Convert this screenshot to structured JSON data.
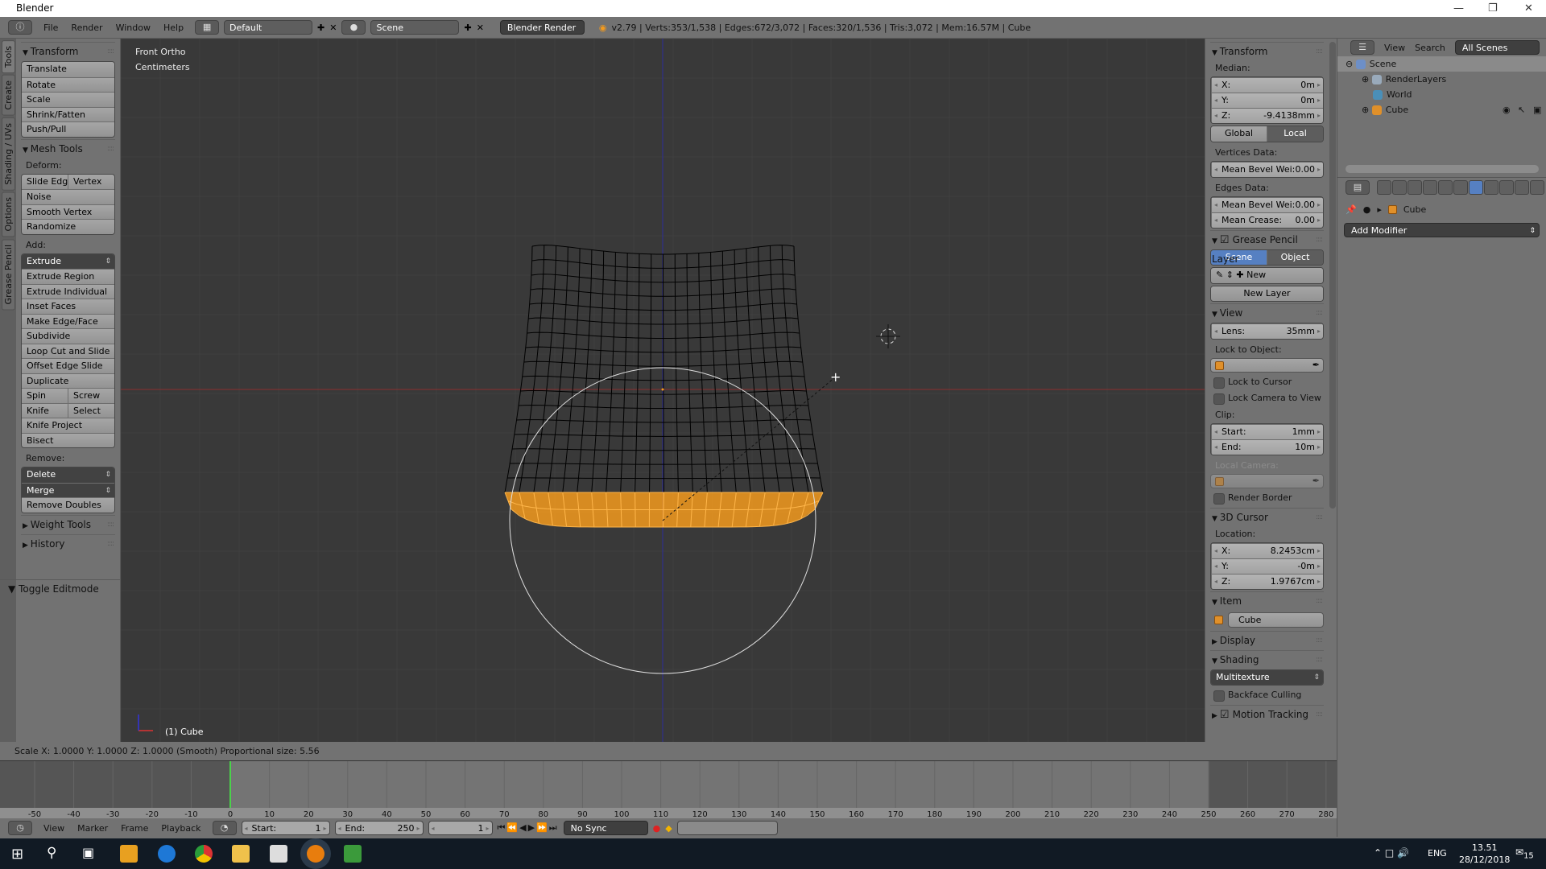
{
  "title_bar": {
    "title": "Blender"
  },
  "header": {
    "menus": [
      "File",
      "Render",
      "Window",
      "Help"
    ],
    "layout": "Default",
    "scene": "Scene",
    "engine": "Blender Render",
    "stats": "v2.79 | Verts:353/1,538 | Edges:672/3,072 | Faces:320/1,536 | Tris:3,072 | Mem:16.57M | Cube"
  },
  "tool_tabs": [
    "Tools",
    "Create",
    "Shading / UVs",
    "Options",
    "Grease Pencil"
  ],
  "tool_shelf": {
    "rows": [
      {
        "t": "h",
        "label": "Transform",
        "open": true
      },
      {
        "t": "g",
        "rows": [
          [
            "Translate"
          ],
          [
            "Rotate"
          ],
          [
            "Scale"
          ],
          [
            "Shrink/Fatten"
          ],
          [
            "Push/Pull"
          ]
        ]
      },
      {
        "t": "h",
        "label": "Mesh Tools",
        "open": true
      },
      {
        "t": "l",
        "label": "Deform:"
      },
      {
        "t": "g",
        "rows": [
          [
            "Slide Edg",
            "Vertex"
          ],
          [
            "Noise"
          ],
          [
            "Smooth Vertex"
          ],
          [
            "Randomize"
          ]
        ]
      },
      {
        "t": "l",
        "label": "Add:"
      },
      {
        "t": "g",
        "dd": [
          0
        ],
        "rows": [
          [
            "Extrude"
          ],
          [
            "Extrude Region"
          ],
          [
            "Extrude Individual"
          ],
          [
            "Inset Faces"
          ],
          [
            "Make Edge/Face"
          ],
          [
            "Subdivide"
          ],
          [
            "Loop Cut and Slide"
          ],
          [
            "Offset Edge Slide"
          ],
          [
            "Duplicate"
          ],
          [
            "Spin",
            "Screw"
          ],
          [
            "Knife",
            "Select"
          ],
          [
            "Knife Project"
          ],
          [
            "Bisect"
          ]
        ]
      },
      {
        "t": "l",
        "label": "Remove:"
      },
      {
        "t": "g",
        "dd": [
          0,
          1
        ],
        "rows": [
          [
            "Delete"
          ],
          [
            "Merge"
          ],
          [
            "Remove Doubles"
          ]
        ]
      },
      {
        "t": "h",
        "label": "Weight Tools",
        "open": false
      },
      {
        "t": "h",
        "label": "History",
        "open": false
      }
    ]
  },
  "toggle_editmode": "Toggle Editmode",
  "viewport": {
    "view_name": "Front Ortho",
    "units": "Centimeters",
    "object_label": "(1) Cube",
    "colors": {
      "background": "#393939",
      "wire": "#000000",
      "selected": "#f39a1d",
      "x_axis": "#8a3030",
      "z_axis": "#30308a"
    }
  },
  "n_panel": {
    "rows": [
      {
        "t": "h",
        "label": "Transform",
        "open": true
      },
      {
        "t": "l",
        "label": "Median:"
      },
      {
        "t": "n",
        "rows": [
          [
            "X:",
            "0m"
          ],
          [
            "Y:",
            "0m"
          ],
          [
            "Z:",
            "-9.4138mm"
          ]
        ]
      },
      {
        "t": "seg",
        "items": [
          "Global",
          "Local"
        ],
        "active": 1,
        "style": "dark"
      },
      {
        "t": "l",
        "label": "Vertices Data:"
      },
      {
        "t": "n",
        "rows": [
          [
            "Mean Bevel Wei:",
            "0.00"
          ]
        ]
      },
      {
        "t": "l",
        "label": "Edges Data:"
      },
      {
        "t": "n",
        "rows": [
          [
            "Mean Bevel Wei:",
            "0.00"
          ],
          [
            "Mean Crease:",
            "0.00"
          ]
        ]
      },
      {
        "t": "h",
        "label": "Grease Pencil Layer",
        "open": true,
        "check": true
      },
      {
        "t": "seg",
        "items": [
          "Scene",
          "Object"
        ],
        "active": 0,
        "style": "blue"
      },
      {
        "t": "g",
        "rows": [
          [
            "✎ ⇕  ✚        New"
          ]
        ]
      },
      {
        "t": "g",
        "center": true,
        "rows": [
          [
            "New Layer"
          ]
        ]
      },
      {
        "t": "h",
        "label": "View",
        "open": true
      },
      {
        "t": "n",
        "rows": [
          [
            "Lens:",
            "35mm"
          ]
        ]
      },
      {
        "t": "l",
        "label": "Lock to Object:"
      },
      {
        "t": "o"
      },
      {
        "t": "c",
        "label": "Lock to Cursor"
      },
      {
        "t": "c",
        "label": "Lock Camera to View"
      },
      {
        "t": "l",
        "label": "Clip:"
      },
      {
        "t": "n",
        "rows": [
          [
            "Start:",
            "1mm"
          ],
          [
            "End:",
            "10m"
          ]
        ]
      },
      {
        "t": "l",
        "label": "Local Camera:",
        "dim": true
      },
      {
        "t": "o",
        "dim": true
      },
      {
        "t": "c",
        "label": "Render Border"
      },
      {
        "t": "h",
        "label": "3D Cursor",
        "open": true
      },
      {
        "t": "l",
        "label": "Location:"
      },
      {
        "t": "n",
        "rows": [
          [
            "X:",
            "8.2453cm"
          ],
          [
            "Y:",
            "-0m"
          ],
          [
            "Z:",
            "1.9767cm"
          ]
        ]
      },
      {
        "t": "h",
        "label": "Item",
        "open": true
      },
      {
        "t": "item",
        "value": "Cube"
      },
      {
        "t": "h",
        "label": "Display",
        "open": false
      },
      {
        "t": "h",
        "label": "Shading",
        "open": true
      },
      {
        "t": "g",
        "dd": [
          0
        ],
        "rows": [
          [
            "Multitexture"
          ]
        ]
      },
      {
        "t": "c",
        "label": "Backface Culling"
      },
      {
        "t": "h",
        "label": "Motion Tracking",
        "open": false,
        "check": true
      }
    ]
  },
  "outliner": {
    "view": "View",
    "search": "Search",
    "filter": "All Scenes",
    "items": [
      {
        "label": "Scene",
        "depth": 0
      },
      {
        "label": "RenderLayers",
        "depth": 1
      },
      {
        "label": "World",
        "depth": 1
      },
      {
        "label": "Cube",
        "depth": 1
      }
    ]
  },
  "properties": {
    "object": "Cube",
    "add_modifier": "Add Modifier",
    "active_tab": "modifiers"
  },
  "status": "Scale X: 1.0000  Y: 1.0000  Z: 1.0000 (Smooth) Proportional size: 5.56",
  "timeline": {
    "ticks": [
      "-50",
      "-40",
      "-30",
      "-20",
      "-10",
      "0",
      "10",
      "20",
      "30",
      "40",
      "50",
      "60",
      "70",
      "80",
      "90",
      "100",
      "110",
      "120",
      "130",
      "140",
      "150",
      "160",
      "170",
      "180",
      "190",
      "200",
      "210",
      "220",
      "230",
      "240",
      "250",
      "260",
      "270",
      "280"
    ],
    "current_frame": 0,
    "menus": [
      "View",
      "Marker",
      "Frame",
      "Playback"
    ],
    "start_label": "Start:",
    "start": "1",
    "end_label": "End:",
    "end": "250",
    "frame": "1",
    "sync": "No Sync"
  },
  "taskbar": {
    "lang": "ENG",
    "time": "13.51",
    "date": "28/12/2018",
    "notifications": "15"
  }
}
